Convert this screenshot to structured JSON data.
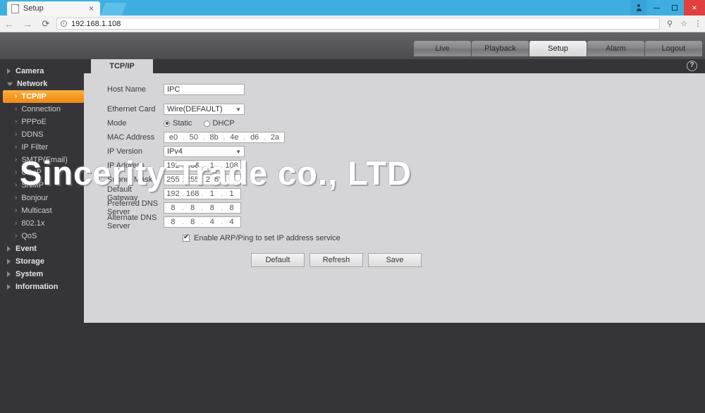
{
  "browser": {
    "tab_title": "Setup",
    "tab_close": "×",
    "back_icon": "←",
    "forward_icon": "→",
    "reload_icon": "⟳",
    "info_icon": "ⓘ",
    "url": "192.168.1.108",
    "pin_icon": "⚲",
    "bookmark_icon": "☆",
    "menu_icon": "⋮",
    "minimize_label": "—",
    "maximize_label": "▢",
    "close_label": "×"
  },
  "topnav": {
    "items": [
      {
        "label": "Live",
        "active": false
      },
      {
        "label": "Playback",
        "active": false
      },
      {
        "label": "Setup",
        "active": true
      },
      {
        "label": "Alarm",
        "active": false
      },
      {
        "label": "Logout",
        "active": false
      }
    ]
  },
  "sidebar": {
    "groups": [
      {
        "label": "Camera",
        "open": false
      },
      {
        "label": "Network",
        "open": true
      },
      {
        "label": "Event",
        "open": false
      },
      {
        "label": "Storage",
        "open": false
      },
      {
        "label": "System",
        "open": false
      },
      {
        "label": "Information",
        "open": false
      }
    ],
    "network_items": [
      {
        "label": "TCP/IP",
        "active": true
      },
      {
        "label": "Connection",
        "active": false
      },
      {
        "label": "PPPoE",
        "active": false
      },
      {
        "label": "DDNS",
        "active": false
      },
      {
        "label": "IP Filter",
        "active": false
      },
      {
        "label": "SMTP(Email)",
        "active": false
      },
      {
        "label": "UPnP",
        "active": false
      },
      {
        "label": "SNMP",
        "active": false
      },
      {
        "label": "Bonjour",
        "active": false
      },
      {
        "label": "Multicast",
        "active": false
      },
      {
        "label": "802.1x",
        "active": false
      },
      {
        "label": "QoS",
        "active": false
      }
    ],
    "chevron": "›"
  },
  "content": {
    "tab_label": "TCP/IP",
    "help_label": "?"
  },
  "form": {
    "host_name": {
      "label": "Host Name",
      "value": "IPC"
    },
    "ethernet_card": {
      "label": "Ethernet Card",
      "value": "Wire(DEFAULT)",
      "arrow": "▼"
    },
    "mode": {
      "label": "Mode",
      "options": [
        {
          "label": "Static",
          "selected": true
        },
        {
          "label": "DHCP",
          "selected": false
        }
      ]
    },
    "mac_address": {
      "label": "MAC Address",
      "octets": [
        "e0",
        "50",
        "8b",
        "4e",
        "d6",
        "2a"
      ],
      "separator": "."
    },
    "ip_version": {
      "label": "IP Version",
      "value": "IPv4",
      "arrow": "▼"
    },
    "ip_address": {
      "label": "IP Address",
      "octets": [
        "192",
        "168",
        "1",
        "108"
      ],
      "separator": "."
    },
    "subnet_mask": {
      "label": "Subnet Mask",
      "octets": [
        "255",
        "255",
        "255",
        "0"
      ],
      "separator": "."
    },
    "default_gateway": {
      "label": "Default Gateway",
      "octets": [
        "192",
        "168",
        "1",
        "1"
      ],
      "separator": "."
    },
    "preferred_dns": {
      "label": "Preferred DNS Server",
      "octets": [
        "8",
        "8",
        "8",
        "8"
      ],
      "separator": "."
    },
    "alternate_dns": {
      "label": "Alternate DNS Server",
      "octets": [
        "8",
        "8",
        "4",
        "4"
      ],
      "separator": "."
    },
    "arp_ping": {
      "label": "Enable ARP/Ping to set IP address service",
      "checked": true
    },
    "buttons": [
      {
        "label": "Default"
      },
      {
        "label": "Refresh"
      },
      {
        "label": "Save"
      }
    ]
  },
  "watermark": {
    "text": "Sincerity Trade co., LTD"
  },
  "colors": {
    "accent_orange": "#f59a21",
    "sidebar_bg": "#353539",
    "content_bg": "#d5d5d8",
    "browser_blue": "#3eaee0",
    "close_red": "#e04040"
  }
}
